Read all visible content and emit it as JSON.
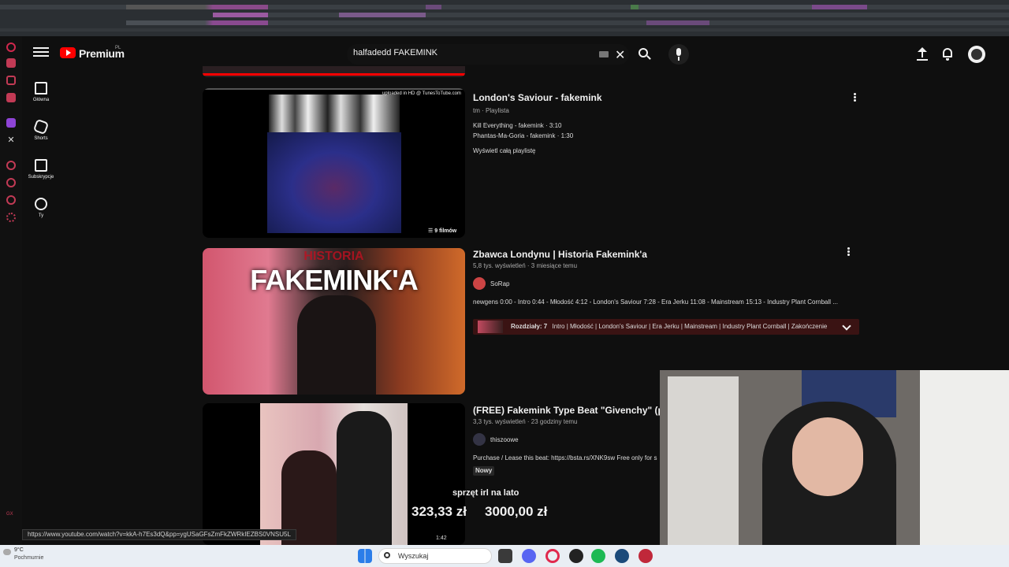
{
  "header": {
    "brand": "Premium",
    "region": "PL",
    "search_value": "halfadedd FAKEMINK"
  },
  "guide": [
    {
      "label": "Główna",
      "icon": "home-icon"
    },
    {
      "label": "Shorts",
      "icon": "shorts-icon"
    },
    {
      "label": "Subskrypcje",
      "icon": "subscriptions-icon"
    },
    {
      "label": "Ty",
      "icon": "you-icon"
    }
  ],
  "results": {
    "playlist": {
      "title": "London's Saviour - fakemink",
      "meta": "tm · Playlista",
      "tracks": [
        "Kill Everything - fakemink · 3:10",
        "Phantas-Ma-Goria - fakemink · 1:30"
      ],
      "view_all": "Wyświetl całą playlistę",
      "count_badge": "9 filmów",
      "upload_tag": "uploaded in HD @ TunesToTube.com"
    },
    "video1": {
      "title": "Zbawca Londynu | Historia Fakemink'a",
      "meta": "5,8 tys. wyświetleń · 3 miesiące temu",
      "channel": "SoRap",
      "description": "newgens 0:00 - Intro 0:44 - Młodość 4:12 - London's Saviour 7:28 - Era Jerku 11:08 - Mainstream 15:13 - Industry Plant Cornball ...",
      "chapters_label": "Rozdziały: 7",
      "chapters_text": "Intro | Młodość | London's Saviour | Era Jerku | Mainstream | Industry Plant Cornball | Zakończenie",
      "thumb_headline": "FAKEMINK'A",
      "thumb_kicker": "HISTORIA"
    },
    "video2": {
      "title": "(FREE) Fakemink Type Beat \"Givenchy\" (prod.",
      "meta": "3,3 tys. wyświetleń · 23 godziny temu",
      "channel": "thiszoowe",
      "description": "Purchase / Lease this beat: https://bsta.rs/XNK9sw Free only for s",
      "badge": "Nowy",
      "duration": "1:42"
    }
  },
  "overlay": {
    "banner_title": "sprzęt irl na lato",
    "amount_current": "323,33 zł",
    "amount_goal": "3000,00 zł"
  },
  "status_url": "https://www.youtube.com/watch?v=kkA-h7Es3dQ&pp=ygUSaGFsZmFkZWRkIEZBS0VNSU5L",
  "taskbar": {
    "weather_temp": "9°C",
    "weather_desc": "Pochmurnie",
    "search_label": "Wyszukaj"
  }
}
